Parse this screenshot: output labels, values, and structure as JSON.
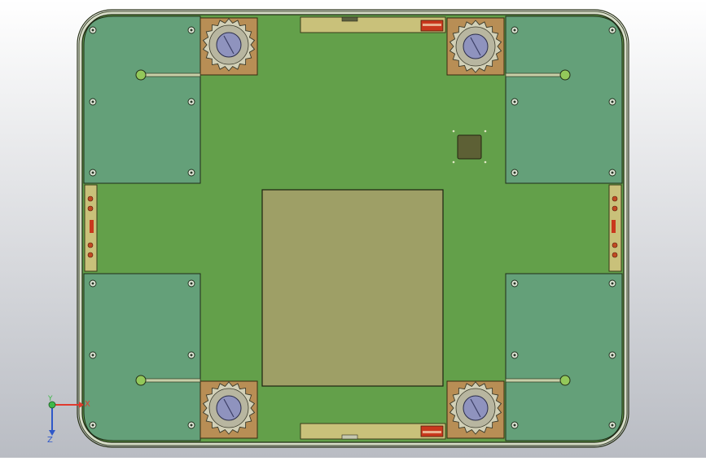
{
  "viewport": {
    "background_top": "#ffffff",
    "background_bottom": "#b9bcc3"
  },
  "colors": {
    "board": "#63a04a",
    "board_edge": "#1e2a12",
    "frame_rim": "#d6dcc8",
    "corner_panel": "#64a079",
    "center_panel": "#9e9f66",
    "wheel_block": "#b88e55",
    "gear": "#d2d0b7",
    "axle": "#8f93be",
    "rail": "#c9c17a",
    "latch_red": "#c9381d",
    "chip": "#5d6035",
    "pin_dot": "#e1e7c5",
    "side_port_dot": "#c04a22"
  },
  "icons": {
    "wheel": "gear-wheel-icon",
    "screw": "screw-hole-icon",
    "spring_rod": "spring-rod-icon",
    "chip": "chip-icon",
    "axis": "xyz-triad-icon"
  },
  "axis_triad": {
    "x_label": "X",
    "y_label": "Y",
    "z_label": "Z",
    "x_color": "#e03a2e",
    "y_color": "#3fb84a",
    "z_color": "#2f58c8"
  }
}
